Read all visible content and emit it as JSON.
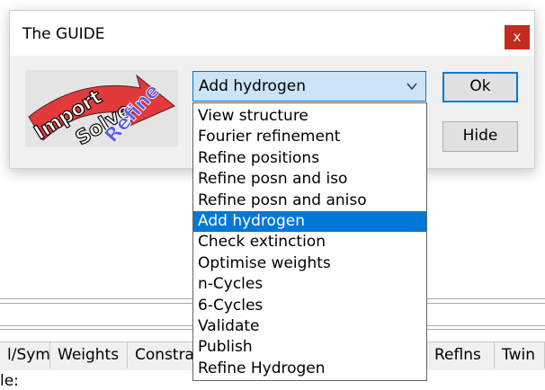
{
  "dialog": {
    "title": "The GUIDE",
    "close_label": "x",
    "logo_words": [
      "Import",
      "Solve",
      "Refine"
    ],
    "combo_value": "Add hydrogen",
    "ok_label": "Ok",
    "hide_label": "Hide"
  },
  "dropdown": {
    "selected": "Add hydrogen",
    "options": [
      "View structure",
      "Fourier refinement",
      "Refine positions",
      "Refine posn and iso",
      "Refine posn and aniso",
      "Add hydrogen",
      "Check extinction",
      "Optimise weights",
      "n-Cycles",
      "6-Cycles",
      "Validate",
      "Publish",
      "Refine Hydrogen"
    ]
  },
  "background": {
    "tabs": [
      "l/Sym",
      "Weights",
      "Constra",
      "Reflns",
      "Twin"
    ],
    "file_label": "le:"
  },
  "colors": {
    "accent": "#0078d7",
    "combo_bg": "#cce4f7",
    "close_red": "#c42b1c",
    "dialog_bg": "#f0f0f0",
    "logo_arrow": "#e03a3a"
  }
}
